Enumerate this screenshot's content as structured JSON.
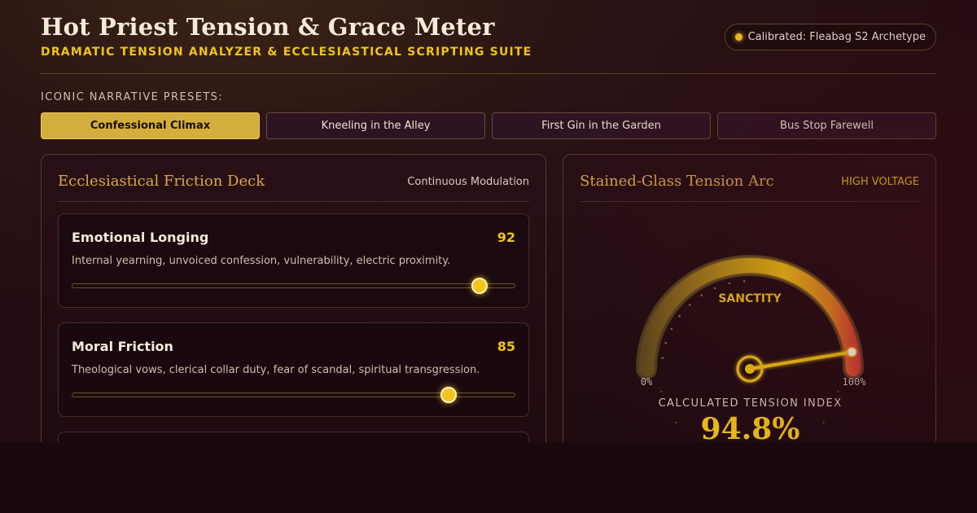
{
  "header": {
    "title": "Hot Priest Tension & Grace Meter",
    "subtitle": "DRAMATIC TENSION ANALYZER & ECCLESIASTICAL SCRIPTING SUITE",
    "badge": "Calibrated: Fleabag S2 Archetype"
  },
  "presets": {
    "label": "ICONIC NARRATIVE PRESETS:",
    "items": [
      {
        "label": "Confessional Climax",
        "active": true
      },
      {
        "label": "Kneeling in the Alley",
        "active": false
      },
      {
        "label": "First Gin in the Garden",
        "active": false
      },
      {
        "label": "Bus Stop Farewell",
        "active": false
      }
    ]
  },
  "deck": {
    "title": "Ecclesiastical Friction Deck",
    "tag": "Continuous Modulation",
    "sliders": [
      {
        "name": "Emotional Longing",
        "value": 92,
        "description": "Internal yearning, unvoiced confession, vulnerability, electric proximity."
      },
      {
        "name": "Moral Friction",
        "value": 85,
        "description": "Theological vows, clerical collar duty, fear of scandal, spiritual transgression."
      }
    ]
  },
  "arc": {
    "title": "Stained-Glass Tension Arc",
    "tag": "HIGH VOLTAGE",
    "gauge_label": "SANCTITY",
    "min_label": "0%",
    "max_label": "100%",
    "caption": "CALCULATED TENSION INDEX",
    "value_text": "94.8%",
    "value": 94.8,
    "colors": {
      "accent": "#f5c518",
      "hot": "#d42a3c",
      "track": "#4a3a22"
    }
  }
}
